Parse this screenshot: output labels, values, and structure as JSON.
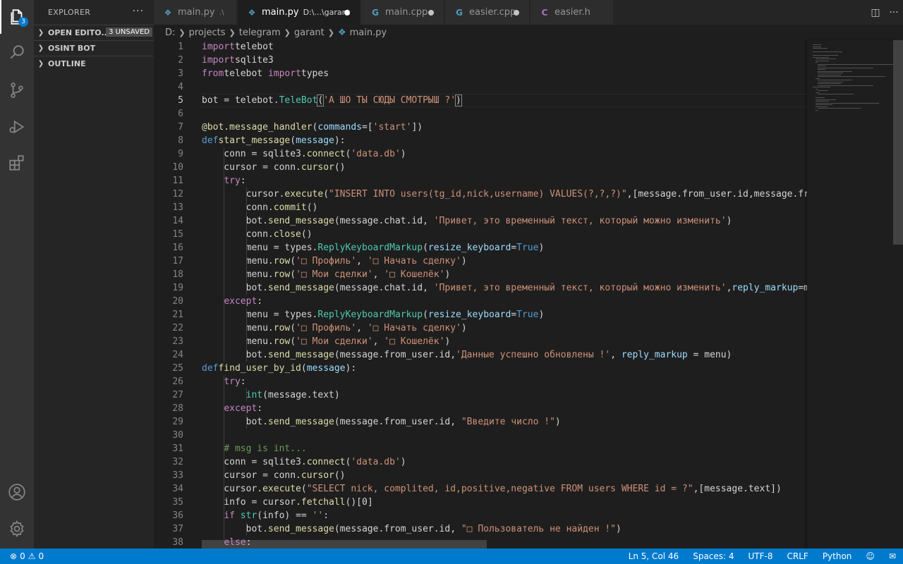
{
  "activity_bar": {
    "explorer_badge": "3",
    "icons": [
      "files-icon",
      "search-icon",
      "source-control-icon",
      "run-debug-icon",
      "extensions-icon",
      "account-icon",
      "settings-gear-icon"
    ]
  },
  "sidebar": {
    "title": "EXPLORER",
    "more": "···",
    "sections": [
      {
        "label": "OPEN EDITO...",
        "badge": "3 UNSAVED"
      },
      {
        "label": "OSINT BOT"
      },
      {
        "label": "OUTLINE"
      }
    ]
  },
  "tabs": [
    {
      "name": "main.py",
      "desc": ".\\",
      "icon": "python-icon",
      "active": false,
      "dirty": false
    },
    {
      "name": "main.py",
      "desc": "D:\\...\\garant",
      "icon": "python-icon",
      "active": true,
      "dirty": true
    },
    {
      "name": "main.cpp",
      "icon": "cpp-icon",
      "active": false,
      "dirty": true
    },
    {
      "name": "easier.cpp",
      "icon": "cpp-icon",
      "active": false,
      "dirty": true
    },
    {
      "name": "easier.h",
      "icon": "c-header-icon",
      "active": false,
      "dirty": false
    }
  ],
  "breadcrumb": [
    "D:",
    "projects",
    "telegram",
    "garant",
    "main.py"
  ],
  "editor": {
    "current_line": 5,
    "lines": [
      [
        [
          "kw",
          "import"
        ],
        [
          "",
          "telebot"
        ]
      ],
      [
        [
          "kw",
          "import"
        ],
        [
          "",
          "sqlite3"
        ]
      ],
      [
        [
          "kw",
          "from"
        ],
        [
          "",
          "telebot "
        ],
        [
          "kw",
          "import"
        ],
        [
          "",
          "types"
        ]
      ],
      [],
      [
        [
          "",
          "bot = telebot."
        ],
        [
          "t",
          "TeleBot"
        ],
        [
          "bm",
          "("
        ],
        [
          "s",
          "'А ШО ТЫ СЮДЫ СМОТРЫШ ?'"
        ],
        [
          "bm",
          ")"
        ]
      ],
      [],
      [
        [
          "d",
          "@bot.message_handler"
        ],
        [
          "",
          "("
        ],
        [
          "p",
          "commands"
        ],
        [
          "",
          "=["
        ],
        [
          "s",
          "'start'"
        ],
        [
          "",
          "])"
        ]
      ],
      [
        [
          "k",
          "def"
        ],
        [
          "f",
          "start_message"
        ],
        [
          "",
          "("
        ],
        [
          "p",
          "message"
        ],
        [
          "",
          "):"
        ]
      ],
      [
        [
          "",
          "    conn = sqlite3."
        ],
        [
          "f",
          "connect"
        ],
        [
          "",
          "("
        ],
        [
          "s",
          "'data.db'"
        ],
        [
          "",
          ")"
        ]
      ],
      [
        [
          "",
          "    cursor = conn."
        ],
        [
          "f",
          "cursor"
        ],
        [
          "",
          "()"
        ]
      ],
      [
        [
          "",
          "    "
        ],
        [
          "kw",
          "try"
        ],
        [
          "",
          ":"
        ]
      ],
      [
        [
          "",
          "        cursor."
        ],
        [
          "f",
          "execute"
        ],
        [
          "",
          "("
        ],
        [
          "s",
          "\"INSERT INTO users(tg_id,nick,username) VALUES(?,?,?)\""
        ],
        [
          "",
          ",[message.from_user.id,message.from_user.first_name"
        ]
      ],
      [
        [
          "",
          "        conn."
        ],
        [
          "f",
          "commit"
        ],
        [
          "",
          "()"
        ]
      ],
      [
        [
          "",
          "        bot."
        ],
        [
          "f",
          "send_message"
        ],
        [
          "",
          "(message.chat.id, "
        ],
        [
          "s",
          "'Привет, это временный текст, который можно изменить'"
        ],
        [
          "",
          ")"
        ]
      ],
      [
        [
          "",
          "        conn."
        ],
        [
          "f",
          "close"
        ],
        [
          "",
          "()"
        ]
      ],
      [
        [
          "",
          "        menu = types."
        ],
        [
          "t",
          "ReplyKeyboardMarkup"
        ],
        [
          "",
          "("
        ],
        [
          "p",
          "resize_keyboard"
        ],
        [
          "",
          "="
        ],
        [
          "k",
          "True"
        ],
        [
          "",
          ")"
        ]
      ],
      [
        [
          "",
          "        menu."
        ],
        [
          "f",
          "row"
        ],
        [
          "",
          "("
        ],
        [
          "s",
          "'□ Профиль'"
        ],
        [
          "",
          ", "
        ],
        [
          "s",
          "'□ Начать сделку'"
        ],
        [
          "",
          ")"
        ]
      ],
      [
        [
          "",
          "        menu."
        ],
        [
          "f",
          "row"
        ],
        [
          "",
          "("
        ],
        [
          "s",
          "'□ Мои сделки'"
        ],
        [
          "",
          ", "
        ],
        [
          "s",
          "'□ Кошелёк'"
        ],
        [
          "",
          ")"
        ]
      ],
      [
        [
          "",
          "        bot."
        ],
        [
          "f",
          "send_message"
        ],
        [
          "",
          "(message.chat.id, "
        ],
        [
          "s",
          "'Привет, это временный текст, который можно изменить'"
        ],
        [
          "",
          ","
        ],
        [
          "p",
          "reply_markup"
        ],
        [
          "",
          "=menu)"
        ]
      ],
      [
        [
          "",
          "    "
        ],
        [
          "kw",
          "except"
        ],
        [
          "",
          ":"
        ]
      ],
      [
        [
          "",
          "        menu = types."
        ],
        [
          "t",
          "ReplyKeyboardMarkup"
        ],
        [
          "",
          "("
        ],
        [
          "p",
          "resize_keyboard"
        ],
        [
          "",
          "="
        ],
        [
          "k",
          "True"
        ],
        [
          "",
          ")"
        ]
      ],
      [
        [
          "",
          "        menu."
        ],
        [
          "f",
          "row"
        ],
        [
          "",
          "("
        ],
        [
          "s",
          "'□ Профиль'"
        ],
        [
          "",
          ", "
        ],
        [
          "s",
          "'□ Начать сделку'"
        ],
        [
          "",
          ")"
        ]
      ],
      [
        [
          "",
          "        menu."
        ],
        [
          "f",
          "row"
        ],
        [
          "",
          "("
        ],
        [
          "s",
          "'□ Мои сделки'"
        ],
        [
          "",
          ", "
        ],
        [
          "s",
          "'□ Кошелёк'"
        ],
        [
          "",
          ")"
        ]
      ],
      [
        [
          "",
          "        bot."
        ],
        [
          "f",
          "send_message"
        ],
        [
          "",
          "(message.from_user.id,"
        ],
        [
          "s",
          "'Данные успешно обновлены !'"
        ],
        [
          "",
          ", "
        ],
        [
          "p",
          "reply_markup"
        ],
        [
          "",
          " = menu)"
        ]
      ],
      [
        [
          "k",
          "def"
        ],
        [
          "f",
          "find_user_by_id"
        ],
        [
          "",
          "("
        ],
        [
          "p",
          "message"
        ],
        [
          "",
          "):"
        ]
      ],
      [
        [
          "",
          "    "
        ],
        [
          "kw",
          "try"
        ],
        [
          "",
          ":"
        ]
      ],
      [
        [
          "",
          "        "
        ],
        [
          "t",
          "int"
        ],
        [
          "",
          "(message.text)"
        ]
      ],
      [
        [
          "",
          "    "
        ],
        [
          "kw",
          "except"
        ],
        [
          "",
          ":"
        ]
      ],
      [
        [
          "",
          "        bot."
        ],
        [
          "f",
          "send_message"
        ],
        [
          "",
          "(message.from_user.id, "
        ],
        [
          "s",
          "\"Введите число !\""
        ],
        [
          "",
          ")"
        ]
      ],
      [],
      [
        [
          "",
          "    "
        ],
        [
          "c",
          "# msg is int..."
        ]
      ],
      [
        [
          "",
          "    conn = sqlite3."
        ],
        [
          "f",
          "connect"
        ],
        [
          "",
          "("
        ],
        [
          "s",
          "'data.db'"
        ],
        [
          "",
          ")"
        ]
      ],
      [
        [
          "",
          "    cursor = conn."
        ],
        [
          "f",
          "cursor"
        ],
        [
          "",
          "()"
        ]
      ],
      [
        [
          "",
          "    cursor."
        ],
        [
          "f",
          "execute"
        ],
        [
          "",
          "("
        ],
        [
          "s",
          "\"SELECT nick, complited, id,positive,negative FROM users WHERE id = ?\""
        ],
        [
          "",
          ",[message.text])"
        ]
      ],
      [
        [
          "",
          "    info = cursor."
        ],
        [
          "f",
          "fetchall"
        ],
        [
          "",
          "()[0]"
        ]
      ],
      [
        [
          "",
          "    "
        ],
        [
          "kw",
          "if"
        ],
        [
          "",
          " "
        ],
        [
          "t",
          "str"
        ],
        [
          "",
          "(info) == "
        ],
        [
          "s",
          "''"
        ],
        [
          "",
          ":"
        ]
      ],
      [
        [
          "",
          "        bot."
        ],
        [
          "f",
          "send_message"
        ],
        [
          "",
          "(message.from_user.id, "
        ],
        [
          "s",
          "\"□ Пользователь не найден !\""
        ],
        [
          "",
          ")"
        ]
      ],
      [
        [
          "",
          "    "
        ],
        [
          "kw",
          "else"
        ],
        [
          "",
          ":"
        ]
      ]
    ]
  },
  "status": {
    "errors": "0",
    "warnings": "0",
    "position": "Ln 5, Col 46",
    "spaces": "Spaces: 4",
    "encoding": "UTF-8",
    "eol": "CRLF",
    "language": "Python"
  }
}
